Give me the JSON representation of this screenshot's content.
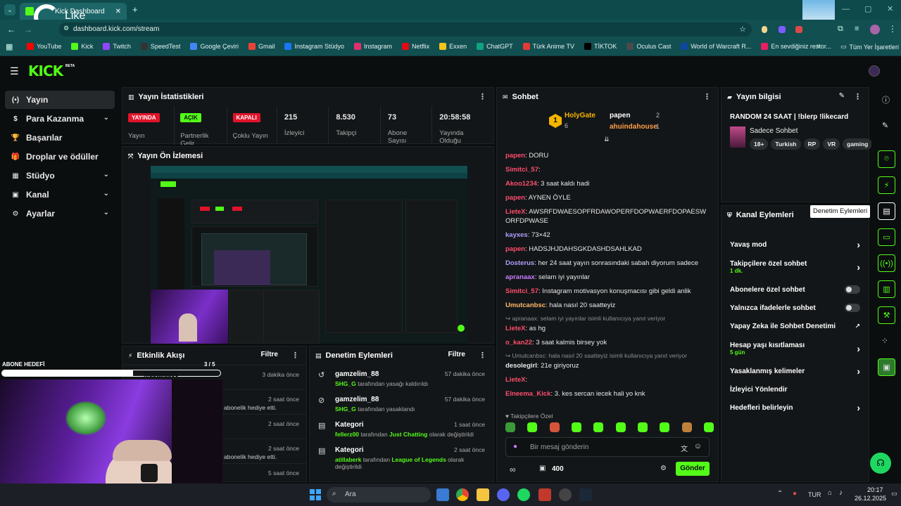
{
  "browser": {
    "tab_title": "Kick Dashboard",
    "watermark": "Like",
    "url": "dashboard.kick.com/stream",
    "bookmarks": [
      "YouTube",
      "Kick",
      "Twitch",
      "SpeedTest",
      "Google Çeviri",
      "Gmail",
      "Instagram Stüdyo",
      "Instagram",
      "Netflix",
      "Exxen",
      "ChatGPT",
      "Türk Anime TV",
      "TİKTOK",
      "Oculus Cast",
      "World of Warcraft R...",
      "En sevdiğiniz restor..."
    ],
    "bookmark_colors": [
      "#ff0000",
      "#53fc18",
      "#9146ff",
      "#333333",
      "#4285f4",
      "#ea4335",
      "#1877f2",
      "#e1306c",
      "#e50914",
      "#f5c518",
      "#10a37f",
      "#e53935",
      "#000000",
      "#4a4a4a",
      "#0d47a1",
      "#e91e63"
    ],
    "all_bookmarks": "Tüm Yer İşaretleri"
  },
  "topnav": {
    "logo": "KICK",
    "beta": "BETA"
  },
  "sidebar": {
    "items": [
      {
        "label": "Yayın",
        "icon": "(•)"
      },
      {
        "label": "Para Kazanma",
        "icon": "$"
      },
      {
        "label": "Başarılar",
        "icon": "🏆"
      },
      {
        "label": "Droplar ve ödüller",
        "icon": "🎁"
      },
      {
        "label": "Stüdyo",
        "icon": "▦"
      },
      {
        "label": "Kanal",
        "icon": "▣"
      },
      {
        "label": "Ayarlar",
        "icon": "⚙"
      }
    ]
  },
  "stats": {
    "title": "Yayın İstatistikleri",
    "items": [
      {
        "value": "YAYINDA",
        "label": "Yayın"
      },
      {
        "value": "AÇIK",
        "label": "Partnerlik Gelir"
      },
      {
        "value": "KAPALI",
        "label": "Çoklu Yayın"
      },
      {
        "value": "215",
        "label": "İzleyici"
      },
      {
        "value": "8.530",
        "label": "Takipçi"
      },
      {
        "value": "73",
        "label": "Abone Sayısı"
      },
      {
        "value": "20:58:58",
        "label": "Yayında Olduğu"
      }
    ]
  },
  "preview": {
    "title": "Yayın Ön İzlemesi"
  },
  "activity": {
    "title": "Etkinlik Akışı",
    "filter": "Filtre",
    "sub_goal_label": "ABONE HEDEFİ",
    "sub_goal_count": "3 / 5",
    "sub_goal_progress": 0.6,
    "sub_goal_user": "Mustafad56",
    "rows": [
      {
        "text": "",
        "time": "3 dakika önce"
      },
      {
        "text": "abonelik hediye etti.",
        "time": "2 saat önce"
      },
      {
        "text": "",
        "time": "2 saat önce"
      },
      {
        "text": "abonelik hediye etti.",
        "time": "2 saat önce"
      },
      {
        "text": "",
        "time": "5 saat önce"
      }
    ]
  },
  "modlog": {
    "title": "Denetim Eylemleri",
    "filter": "Filtre",
    "items": [
      {
        "icon": "↺",
        "title": "gamzelim_88",
        "user": "SHG_G",
        "desc": " tarafından yasağı kaldırıldı",
        "target": "",
        "suffix": "",
        "time": "57 dakika önce"
      },
      {
        "icon": "⊘",
        "title": "gamzelim_88",
        "user": "SHG_G",
        "desc": " tarafından yasaklandı",
        "target": "",
        "suffix": "",
        "time": "57 dakika önce"
      },
      {
        "icon": "▤",
        "title": "Kategori",
        "user": "fellerz00",
        "desc": " tarafından ",
        "target": "Just Chatting",
        "suffix": " olarak değiştirildi",
        "time": "1 saat önce"
      },
      {
        "icon": "▤",
        "title": "Kategori",
        "user": "atillaberk",
        "desc": " tarafından ",
        "target": "League of Legends",
        "suffix": " olarak değiştirildi",
        "time": "2 saat önce"
      }
    ]
  },
  "chat": {
    "title": "Sohbet",
    "leaders": [
      {
        "name": "HolyGate",
        "count": "6",
        "rank": "1"
      },
      {
        "name": "papen",
        "count": "2"
      },
      {
        "name": "ahuindahouse",
        "count": "1"
      }
    ],
    "messages": [
      {
        "user": "papen",
        "color": "#ff4d6d",
        "text": "DORU"
      },
      {
        "user": "Simitci_57",
        "color": "#ff4d6d",
        "text": ""
      },
      {
        "user": "Akoo1234",
        "color": "#ff4d6d",
        "text": "3 saat kaldı hadi"
      },
      {
        "user": "papen",
        "color": "#ff4d6d",
        "text": "AYNEN ÖYLE"
      },
      {
        "user": "LieteX",
        "color": "#ff4d6d",
        "text": "AWSRFDWAESOPFRDAWOPERFDOPWAERFDOPAESWORFDPWASE"
      },
      {
        "user": "kayxes",
        "color": "#b09dff",
        "text": "73×42"
      },
      {
        "user": "papen",
        "color": "#ff4d6d",
        "text": "HADSJHJDAHSGKDASHDSAHLKAD"
      },
      {
        "user": "Dosterus",
        "color": "#b09dff",
        "text": "her 24 saat yayın sonrasındaki sabah diyorum sadece"
      },
      {
        "user": "apranaax",
        "color": "#c77dff",
        "text": "selam iyi yayınlar"
      },
      {
        "user": "Simitci_57",
        "color": "#ff4d6d",
        "text": "Instagram motivasyon konuşmacısı gibi geldi anlik"
      },
      {
        "user": "Umutcanbsc",
        "color": "#ffb86b",
        "text": "hala nasıl 20 saatteyiz"
      },
      {
        "reply": "apranaax: selam iyi yayınlar isimli kullanıcıya yanıt veriyor",
        "user": "LieteX",
        "color": "#ff4d6d",
        "text": "as hg"
      },
      {
        "user": "o_kan22",
        "color": "#ff4d6d",
        "text": "3 saat kalmis birsey yok"
      },
      {
        "reply": "Umutcanbsc: hala nasıl 20 saatteyiz isimli kullanıcıya yanıt veriyor",
        "user": "desolegirl",
        "color": "#e8e8e8",
        "text": "21e giriyoruz"
      },
      {
        "user": "LieteX",
        "color": "#ff4d6d",
        "text": ""
      },
      {
        "user": "Elneema_Kick",
        "color": "#ff4d6d",
        "text": "3. kes sercan iecek hali yo knk"
      }
    ],
    "follower_only": "Takipçilere Özel",
    "placeholder": "Bir mesaj gönderin",
    "points": "400",
    "send": "Gönder"
  },
  "streaminfo": {
    "title": "Yayın bilgisi",
    "stream_title": "RANDOM 24 SAAT",
    "commands": "!blerp !likecard",
    "category": "Sadece Sohbet",
    "tags": [
      "18+",
      "Turkish",
      "RP",
      "VR",
      "gaming"
    ]
  },
  "channel_actions": {
    "title": "Kanal Eylemleri",
    "tooltip": "Denetim Eylemleri",
    "items": [
      {
        "label": "Yavaş mod",
        "sub": "",
        "control": "arrow"
      },
      {
        "label": "Takipçilere özel sohbet",
        "sub": "1 dk.",
        "control": "arrow"
      },
      {
        "label": "Abonelere özel sohbet",
        "sub": "",
        "control": "toggle"
      },
      {
        "label": "Yalnızca ifadelerle sohbet",
        "sub": "",
        "control": "toggle"
      },
      {
        "label": "Yapay Zeka ile Sohbet Denetimi",
        "sub": "",
        "control": "ext"
      },
      {
        "label": "Hesap yaşı kısıtlaması",
        "sub": "5 gün",
        "control": "arrow"
      },
      {
        "label": "Yasaklanmış kelimeler",
        "sub": "",
        "control": "arrow"
      },
      {
        "label": "İzleyici Yönlendir",
        "sub": "",
        "control": "none"
      },
      {
        "label": "Hedefleri belirleyin",
        "sub": "",
        "control": "arrow"
      }
    ]
  },
  "taskbar": {
    "search": "Ara",
    "lang": "TUR",
    "time": "20:17",
    "date": "26.12.2025"
  }
}
